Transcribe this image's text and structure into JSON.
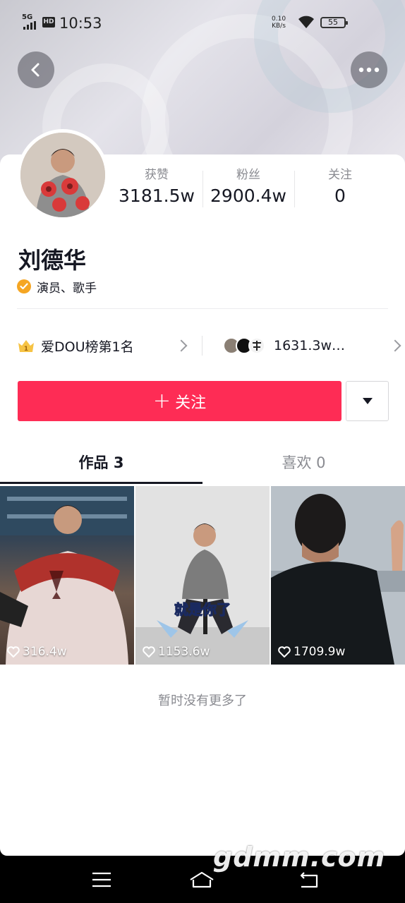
{
  "status_bar": {
    "network": "5G",
    "hd": "HD",
    "time": "10:53",
    "speed_value": "0.10",
    "speed_unit": "KB/s",
    "battery": "55"
  },
  "profile": {
    "name": "刘德华",
    "verification": "演员、歌手",
    "stats": [
      {
        "label": "获赞",
        "value": "3181.5w"
      },
      {
        "label": "粉丝",
        "value": "2900.4w"
      },
      {
        "label": "关注",
        "value": "0"
      }
    ]
  },
  "rank": {
    "label": "爱DOU榜第1名",
    "crown_number": "1",
    "fans_count": "1631.3w…"
  },
  "actions": {
    "follow_label": "关注",
    "follow_plus": "+"
  },
  "tabs": [
    {
      "label": "作品 3",
      "active": true
    },
    {
      "label": "喜欢 0",
      "active": false
    }
  ],
  "videos": [
    {
      "likes": "316.4w"
    },
    {
      "likes": "1153.6w",
      "caption": "就是你了"
    },
    {
      "likes": "1709.9w"
    }
  ],
  "end_text": "暂时没有更多了",
  "watermark": "gdmm.com",
  "colors": {
    "accent": "#fe2c55",
    "verify": "#f5a623",
    "text_primary": "#161823",
    "text_secondary": "#8a8b91"
  }
}
